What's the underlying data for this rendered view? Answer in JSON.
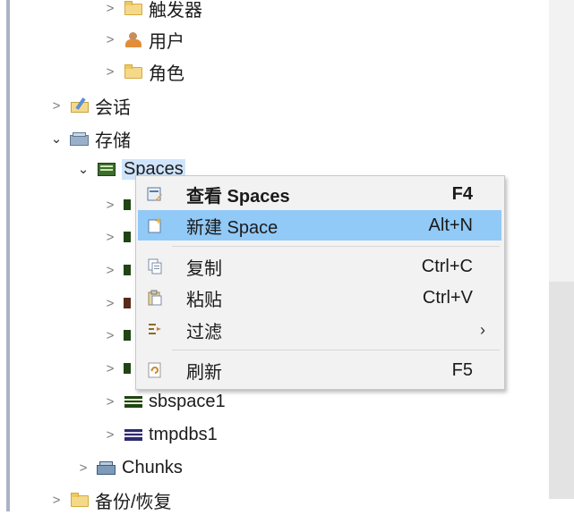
{
  "tree": {
    "items": [
      {
        "label": "触发器",
        "icon": "folder-icon",
        "expanded": false
      },
      {
        "label": "用户",
        "icon": "user-icon",
        "expanded": false
      },
      {
        "label": "角色",
        "icon": "folder-icon",
        "expanded": false
      },
      {
        "label": "会话",
        "icon": "session-icon",
        "expanded": false
      },
      {
        "label": "存储",
        "icon": "storage-icon",
        "expanded": true
      },
      {
        "label": "Spaces",
        "icon": "spaces-icon",
        "expanded": true,
        "selected": true
      },
      {
        "label": "sbspace1",
        "icon": "sbspace-icon",
        "expanded": false
      },
      {
        "label": "tmpdbs1",
        "icon": "tmpdbs-icon",
        "expanded": false
      },
      {
        "label": "Chunks",
        "icon": "chunks-icon",
        "expanded": false
      },
      {
        "label": "备份/恢复",
        "icon": "folder-icon",
        "expanded": false
      }
    ]
  },
  "context_menu": {
    "items": [
      {
        "label": "查看 Spaces",
        "shortcut": "F4",
        "bold": true,
        "icon": "view-icon"
      },
      {
        "label": "新建 Space",
        "shortcut": "Alt+N",
        "highlighted": true,
        "icon": "new-icon"
      },
      {
        "label": "复制",
        "shortcut": "Ctrl+C",
        "icon": "copy-icon"
      },
      {
        "label": "粘贴",
        "shortcut": "Ctrl+V",
        "icon": "paste-icon"
      },
      {
        "label": "过滤",
        "shortcut": "›",
        "icon": "filter-icon"
      },
      {
        "label": "刷新",
        "shortcut": "F5",
        "icon": "refresh-icon"
      }
    ]
  },
  "colors": {
    "menu_highlight": "#91c9f7",
    "menu_background": "#f2f2f2",
    "selection": "#cfe4fa"
  }
}
